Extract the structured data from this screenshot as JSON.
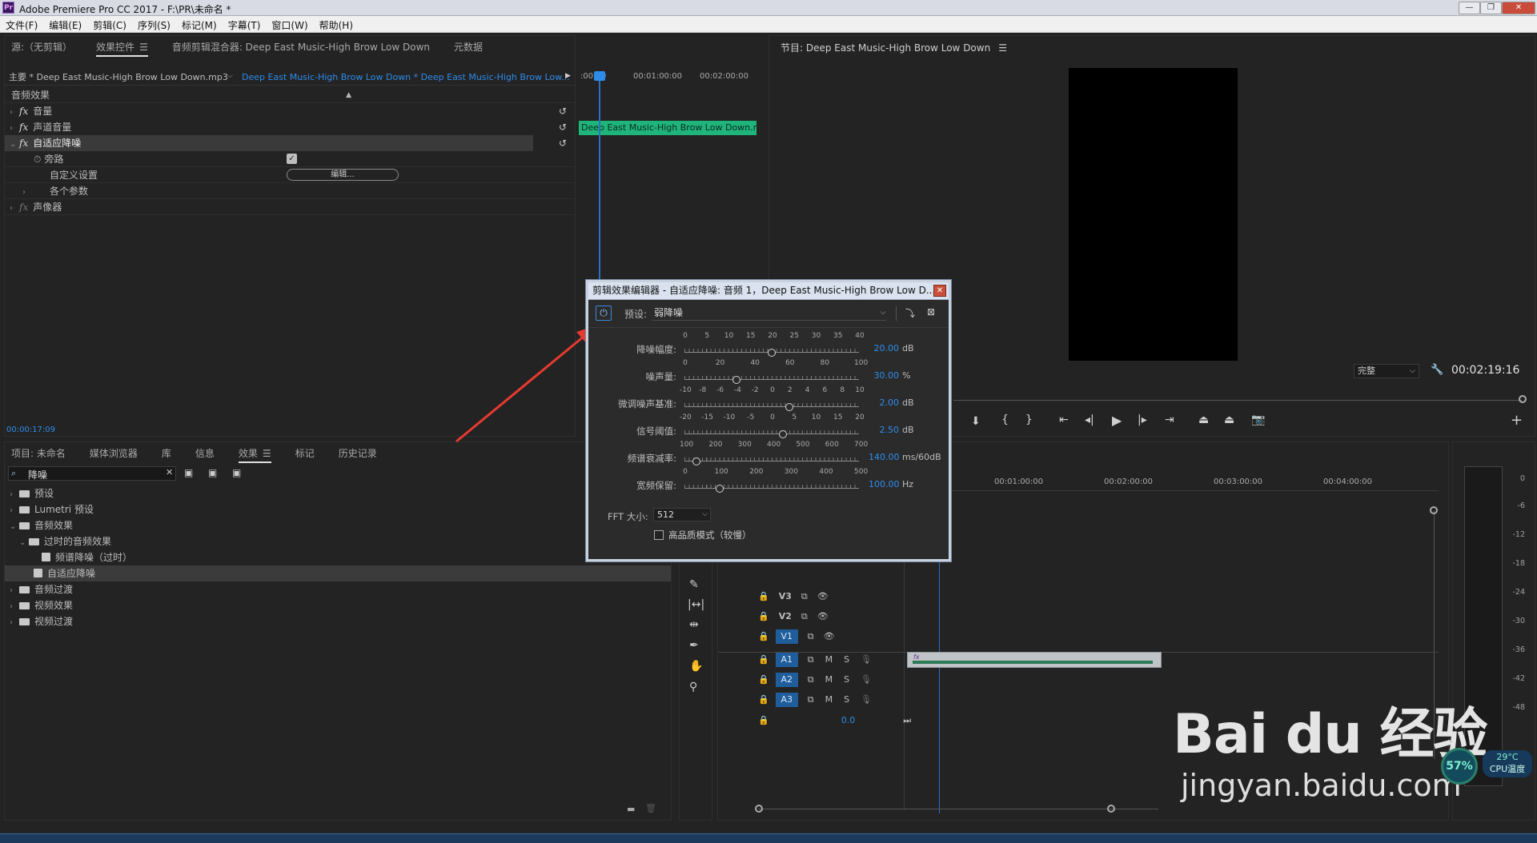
{
  "app": {
    "title": "Adobe Premiere Pro CC 2017 - F:\\PR\\未命名 *",
    "logo": "Pr"
  },
  "menu": [
    "文件(F)",
    "编辑(E)",
    "剪辑(C)",
    "序列(S)",
    "标记(M)",
    "字幕(T)",
    "窗口(W)",
    "帮助(H)"
  ],
  "source_panel": {
    "tabs": [
      "源:（无剪辑）",
      "效果控件",
      "音频剪辑混合器: Deep East Music-High Brow Low Down",
      "元数据"
    ],
    "active_tab": "效果控件",
    "master_clip": "主要 * Deep East Music-High Brow Low Down.mp3",
    "sequence_clip": "Deep East Music-High Brow Low Down * Deep East Music-High Brow Low...",
    "mini_timeline": {
      "t0": ":00:00",
      "t1": "00:01:00:00",
      "t2": "00:02:00:00"
    },
    "clip_name": "Deep East Music-High Brow Low Down.mp",
    "section": "音频效果",
    "effects": [
      {
        "label": "音量"
      },
      {
        "label": "声道音量"
      },
      {
        "label": "自适应降噪"
      }
    ],
    "bypass_label": "旁路",
    "custom_label": "自定义设置",
    "edit_button": "编辑...",
    "params_label": "各个参数",
    "panner_label": "声像器",
    "timecode": "00:00:17:09"
  },
  "program_panel": {
    "title": "节目: Deep East Music-High Brow Low Down",
    "quality": "完整",
    "timecode": "00:02:19:16"
  },
  "project_panel": {
    "tabs": [
      "项目: 未命名",
      "媒体浏览器",
      "库",
      "信息",
      "效果",
      "标记",
      "历史记录"
    ],
    "active_tab": "效果",
    "search_value": "降噪",
    "tree": [
      {
        "label": "预设",
        "level": 0,
        "open": false,
        "kind": "folder"
      },
      {
        "label": "Lumetri 预设",
        "level": 0,
        "open": false,
        "kind": "folder"
      },
      {
        "label": "音频效果",
        "level": 0,
        "open": true,
        "kind": "folder"
      },
      {
        "label": "过时的音频效果",
        "level": 1,
        "open": true,
        "kind": "folder"
      },
      {
        "label": "频谱降噪（过时）",
        "level": 2,
        "open": false,
        "kind": "effect"
      },
      {
        "label": "自适应降噪",
        "level": 1,
        "open": false,
        "kind": "effect",
        "selected": true
      },
      {
        "label": "音频过渡",
        "level": 0,
        "open": false,
        "kind": "folder"
      },
      {
        "label": "视频效果",
        "level": 0,
        "open": false,
        "kind": "folder"
      },
      {
        "label": "视频过渡",
        "level": 0,
        "open": false,
        "kind": "folder"
      }
    ]
  },
  "timeline": {
    "ruler": [
      "00:01:00:00",
      "00:02:00:00",
      "00:03:00:00",
      "00:04:00:00"
    ],
    "video_tracks": [
      "V3",
      "V2",
      "V1"
    ],
    "audio_tracks": [
      "A1",
      "A2",
      "A3"
    ],
    "mute": "M",
    "solo": "S",
    "master_value": "0.0"
  },
  "audio_meter": {
    "labels": [
      "0",
      "-6",
      "-12",
      "-18",
      "-24",
      "-30",
      "-36",
      "-42",
      "-48"
    ]
  },
  "dialog": {
    "title": "剪辑效果编辑器 - 自适应降噪: 音频 1，Deep East Music-High Brow Low D...",
    "preset_label": "预设:",
    "preset_value": "弱降噪",
    "sliders": [
      {
        "label": "降噪幅度:",
        "ticks": [
          "0",
          "5",
          "10",
          "15",
          "20",
          "25",
          "30",
          "35",
          "40"
        ],
        "value": "20.00",
        "unit": "dB",
        "fraction": 0.5
      },
      {
        "label": "噪声量:",
        "ticks": [
          "0",
          "20",
          "40",
          "60",
          "80",
          "100"
        ],
        "value": "30.00",
        "unit": "%",
        "fraction": 0.3
      },
      {
        "label": "微调噪声基准:",
        "ticks": [
          "-10",
          "-8",
          "-6",
          "-4",
          "-2",
          "0",
          "2",
          "4",
          "6",
          "8",
          "10"
        ],
        "value": "2.00",
        "unit": "dB",
        "fraction": 0.6
      },
      {
        "label": "信号阈值:",
        "ticks": [
          "-20",
          "-15",
          "-10",
          "-5",
          "0",
          "5",
          "10",
          "15",
          "20"
        ],
        "value": "2.50",
        "unit": "dB",
        "fraction": 0.5625
      },
      {
        "label": "频谱衰减率:",
        "ticks": [
          "100",
          "200",
          "300",
          "400",
          "500",
          "600",
          "700"
        ],
        "value": "140.00",
        "unit": "ms/60dB",
        "fraction": 0.0667
      },
      {
        "label": "宽频保留:",
        "ticks": [
          "0",
          "100",
          "200",
          "300",
          "400",
          "500"
        ],
        "value": "100.00",
        "unit": "Hz",
        "fraction": 0.2
      }
    ],
    "fft_label": "FFT 大小:",
    "fft_value": "512",
    "hq_label": "高品质模式（较慢）"
  },
  "watermark": {
    "text": "Bai du 经验",
    "url": "jingyan.baidu.com"
  },
  "system": {
    "cpu_percent": "57%",
    "temp": "29°C",
    "temp_label": "CPU温度"
  },
  "colors": {
    "accent": "#2d8ceb",
    "clip_green": "#1fb47a",
    "arrow": "#e53a2f"
  }
}
